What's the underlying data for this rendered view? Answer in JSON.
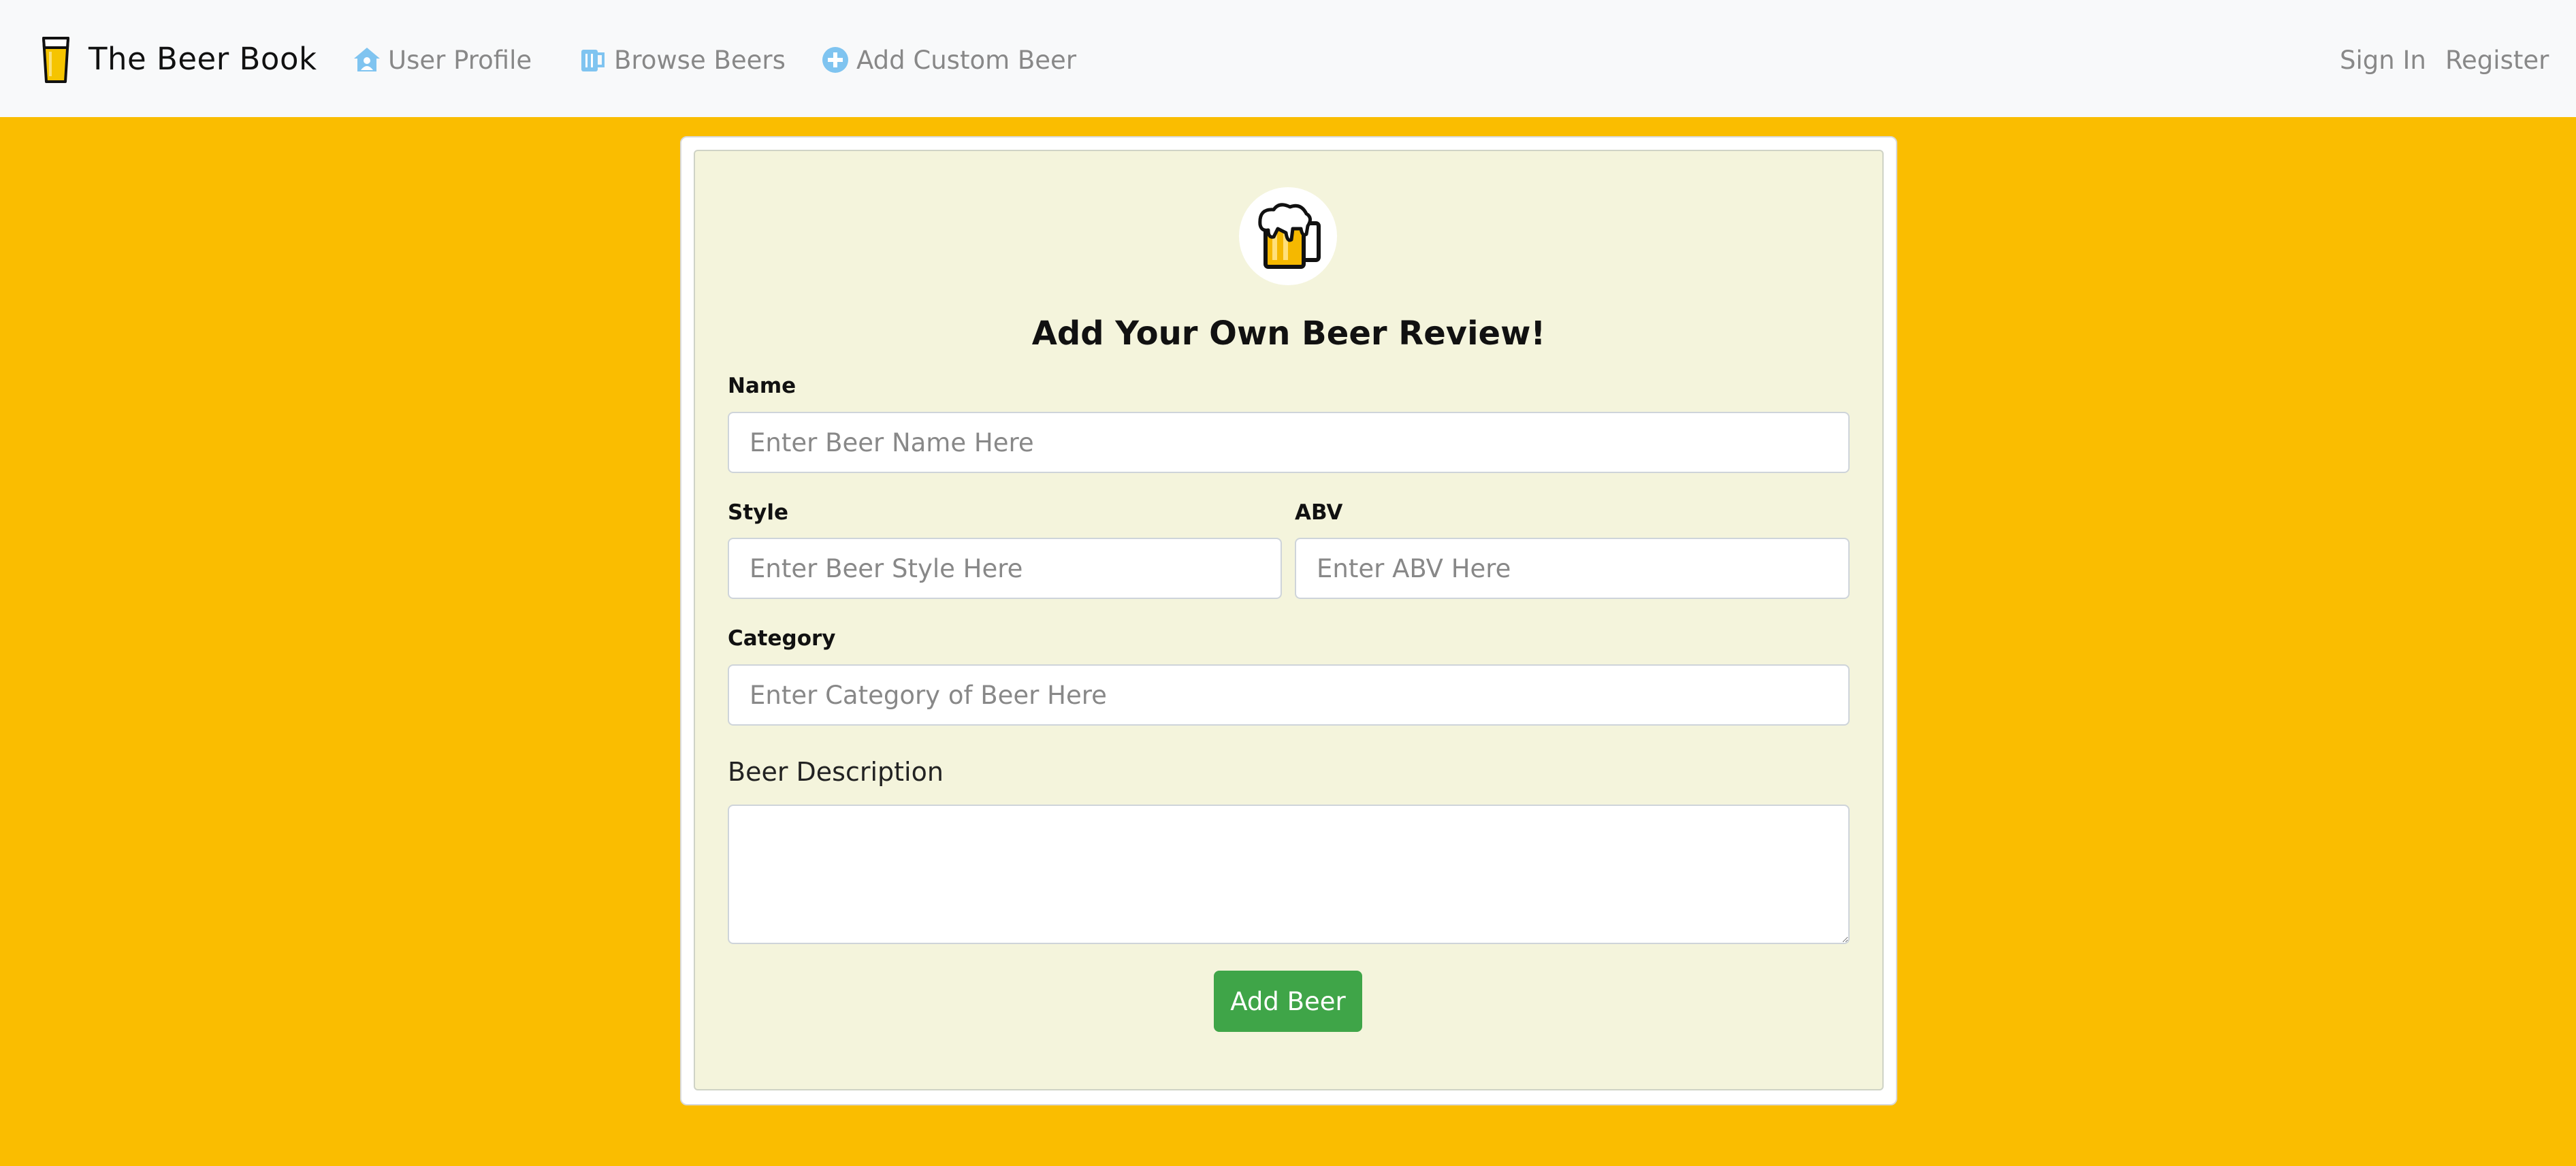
{
  "navbar": {
    "brand": "The Beer Book",
    "links": [
      {
        "label": "User Profile",
        "icon": "user-home-icon"
      },
      {
        "label": "Browse Beers",
        "icon": "beer-mug-icon"
      },
      {
        "label": "Add Custom Beer",
        "icon": "plus-circle-icon"
      }
    ],
    "sign_in": "Sign In",
    "register": "Register"
  },
  "form": {
    "logo_icon": "beer-mug-logo-icon",
    "title": "Add Your Own Beer Review!",
    "name": {
      "label": "Name",
      "placeholder": "Enter Beer Name Here",
      "value": ""
    },
    "style": {
      "label": "Style",
      "placeholder": "Enter Beer Style Here",
      "value": ""
    },
    "abv": {
      "label": "ABV",
      "placeholder": "Enter ABV Here",
      "value": ""
    },
    "category": {
      "label": "Category",
      "placeholder": "Enter Category of Beer Here",
      "value": ""
    },
    "description": {
      "label": "Beer Description",
      "value": ""
    },
    "submit_label": "Add Beer"
  },
  "colors": {
    "background": "#fabd00",
    "navbar": "#f8f9fa",
    "card": "#f4f4dc",
    "button": "#3fa548",
    "nav_icon": "#7fc4f0"
  }
}
